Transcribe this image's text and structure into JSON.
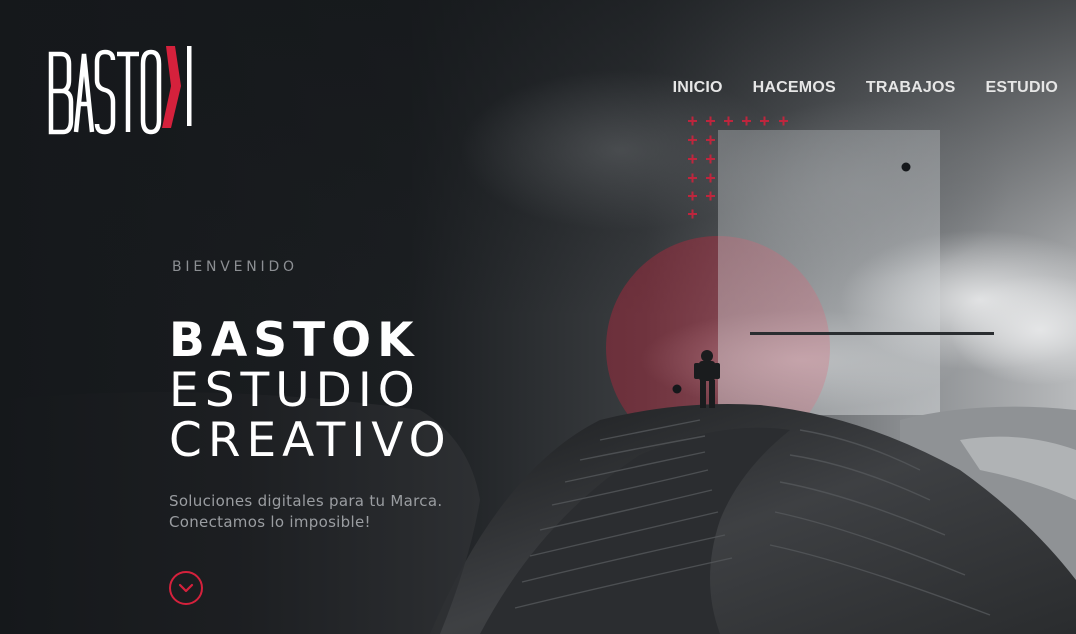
{
  "brand": {
    "logo_text": "BASTOK",
    "accent_color": "#d5213c"
  },
  "nav": {
    "items": [
      {
        "label": "INICIO"
      },
      {
        "label": "HACEMOS"
      },
      {
        "label": "TRABAJOS"
      },
      {
        "label": "ESTUDIO"
      }
    ]
  },
  "hero": {
    "eyebrow": "BIENVENIDO",
    "title_line1": "BASTOK",
    "title_line2": "ESTUDIO",
    "title_line3": "CREATIVO",
    "description_line1": "Soluciones digitales para tu Marca.",
    "description_line2": "Conectamos lo imposible!",
    "scroll_icon": "chevron-down-icon"
  }
}
